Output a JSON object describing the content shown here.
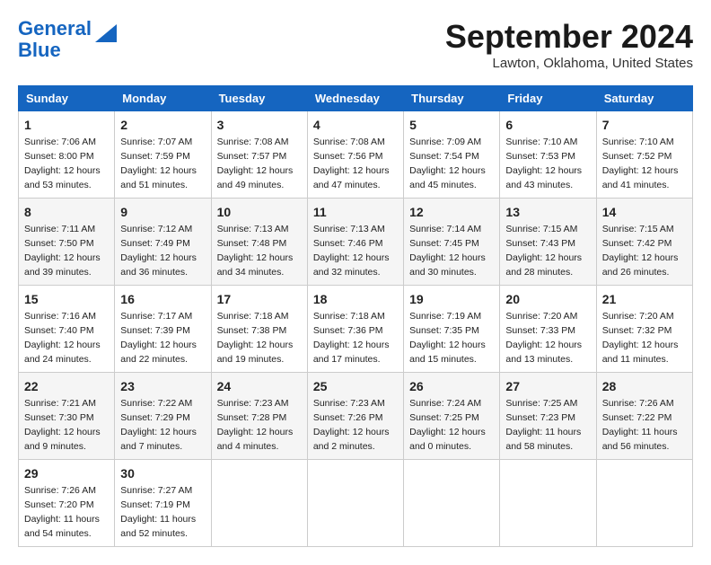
{
  "logo": {
    "line1": "General",
    "line2": "Blue"
  },
  "header": {
    "month": "September 2024",
    "location": "Lawton, Oklahoma, United States"
  },
  "weekdays": [
    "Sunday",
    "Monday",
    "Tuesday",
    "Wednesday",
    "Thursday",
    "Friday",
    "Saturday"
  ],
  "weeks": [
    [
      {
        "day": "1",
        "detail": "Sunrise: 7:06 AM\nSunset: 8:00 PM\nDaylight: 12 hours\nand 53 minutes."
      },
      {
        "day": "2",
        "detail": "Sunrise: 7:07 AM\nSunset: 7:59 PM\nDaylight: 12 hours\nand 51 minutes."
      },
      {
        "day": "3",
        "detail": "Sunrise: 7:08 AM\nSunset: 7:57 PM\nDaylight: 12 hours\nand 49 minutes."
      },
      {
        "day": "4",
        "detail": "Sunrise: 7:08 AM\nSunset: 7:56 PM\nDaylight: 12 hours\nand 47 minutes."
      },
      {
        "day": "5",
        "detail": "Sunrise: 7:09 AM\nSunset: 7:54 PM\nDaylight: 12 hours\nand 45 minutes."
      },
      {
        "day": "6",
        "detail": "Sunrise: 7:10 AM\nSunset: 7:53 PM\nDaylight: 12 hours\nand 43 minutes."
      },
      {
        "day": "7",
        "detail": "Sunrise: 7:10 AM\nSunset: 7:52 PM\nDaylight: 12 hours\nand 41 minutes."
      }
    ],
    [
      {
        "day": "8",
        "detail": "Sunrise: 7:11 AM\nSunset: 7:50 PM\nDaylight: 12 hours\nand 39 minutes."
      },
      {
        "day": "9",
        "detail": "Sunrise: 7:12 AM\nSunset: 7:49 PM\nDaylight: 12 hours\nand 36 minutes."
      },
      {
        "day": "10",
        "detail": "Sunrise: 7:13 AM\nSunset: 7:48 PM\nDaylight: 12 hours\nand 34 minutes."
      },
      {
        "day": "11",
        "detail": "Sunrise: 7:13 AM\nSunset: 7:46 PM\nDaylight: 12 hours\nand 32 minutes."
      },
      {
        "day": "12",
        "detail": "Sunrise: 7:14 AM\nSunset: 7:45 PM\nDaylight: 12 hours\nand 30 minutes."
      },
      {
        "day": "13",
        "detail": "Sunrise: 7:15 AM\nSunset: 7:43 PM\nDaylight: 12 hours\nand 28 minutes."
      },
      {
        "day": "14",
        "detail": "Sunrise: 7:15 AM\nSunset: 7:42 PM\nDaylight: 12 hours\nand 26 minutes."
      }
    ],
    [
      {
        "day": "15",
        "detail": "Sunrise: 7:16 AM\nSunset: 7:40 PM\nDaylight: 12 hours\nand 24 minutes."
      },
      {
        "day": "16",
        "detail": "Sunrise: 7:17 AM\nSunset: 7:39 PM\nDaylight: 12 hours\nand 22 minutes."
      },
      {
        "day": "17",
        "detail": "Sunrise: 7:18 AM\nSunset: 7:38 PM\nDaylight: 12 hours\nand 19 minutes."
      },
      {
        "day": "18",
        "detail": "Sunrise: 7:18 AM\nSunset: 7:36 PM\nDaylight: 12 hours\nand 17 minutes."
      },
      {
        "day": "19",
        "detail": "Sunrise: 7:19 AM\nSunset: 7:35 PM\nDaylight: 12 hours\nand 15 minutes."
      },
      {
        "day": "20",
        "detail": "Sunrise: 7:20 AM\nSunset: 7:33 PM\nDaylight: 12 hours\nand 13 minutes."
      },
      {
        "day": "21",
        "detail": "Sunrise: 7:20 AM\nSunset: 7:32 PM\nDaylight: 12 hours\nand 11 minutes."
      }
    ],
    [
      {
        "day": "22",
        "detail": "Sunrise: 7:21 AM\nSunset: 7:30 PM\nDaylight: 12 hours\nand 9 minutes."
      },
      {
        "day": "23",
        "detail": "Sunrise: 7:22 AM\nSunset: 7:29 PM\nDaylight: 12 hours\nand 7 minutes."
      },
      {
        "day": "24",
        "detail": "Sunrise: 7:23 AM\nSunset: 7:28 PM\nDaylight: 12 hours\nand 4 minutes."
      },
      {
        "day": "25",
        "detail": "Sunrise: 7:23 AM\nSunset: 7:26 PM\nDaylight: 12 hours\nand 2 minutes."
      },
      {
        "day": "26",
        "detail": "Sunrise: 7:24 AM\nSunset: 7:25 PM\nDaylight: 12 hours\nand 0 minutes."
      },
      {
        "day": "27",
        "detail": "Sunrise: 7:25 AM\nSunset: 7:23 PM\nDaylight: 11 hours\nand 58 minutes."
      },
      {
        "day": "28",
        "detail": "Sunrise: 7:26 AM\nSunset: 7:22 PM\nDaylight: 11 hours\nand 56 minutes."
      }
    ],
    [
      {
        "day": "29",
        "detail": "Sunrise: 7:26 AM\nSunset: 7:20 PM\nDaylight: 11 hours\nand 54 minutes."
      },
      {
        "day": "30",
        "detail": "Sunrise: 7:27 AM\nSunset: 7:19 PM\nDaylight: 11 hours\nand 52 minutes."
      },
      null,
      null,
      null,
      null,
      null
    ]
  ]
}
